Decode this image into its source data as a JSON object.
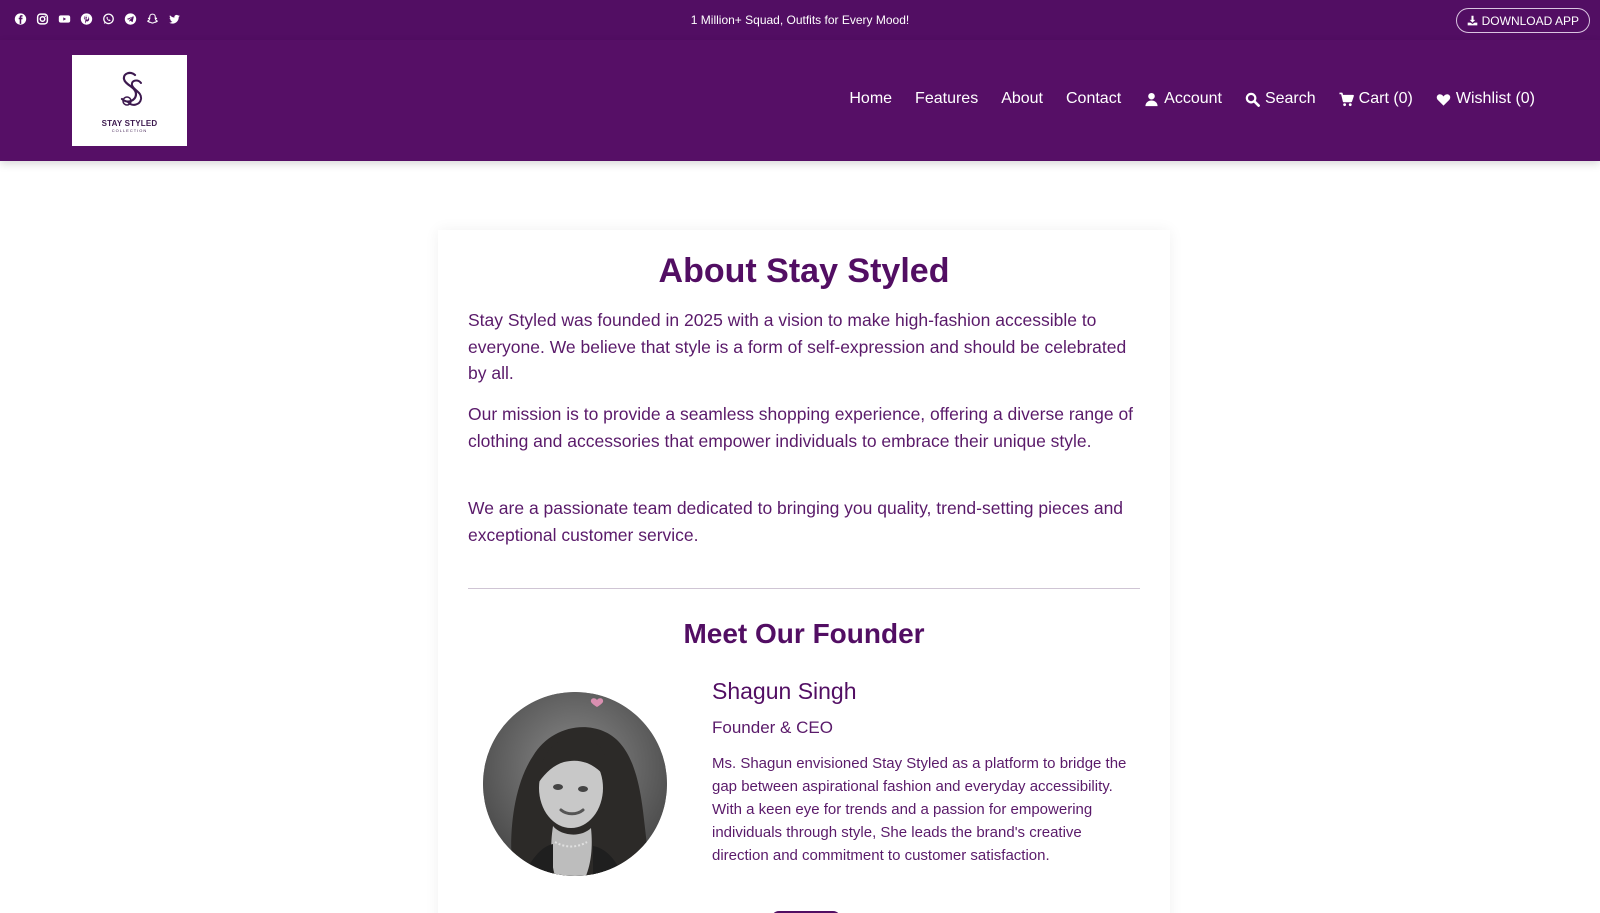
{
  "topbar": {
    "social_icons": [
      "facebook-icon",
      "instagram-icon",
      "youtube-icon",
      "pinterest-icon",
      "whatsapp-icon",
      "telegram-icon",
      "snapchat-icon",
      "twitter-icon"
    ],
    "tagline": "1 Million+ Squad, Outfits for Every Mood!",
    "download_label": "DOWNLOAD APP"
  },
  "brand": {
    "logo_text": "STAY STYLED",
    "logo_subtext": "COLLECTION"
  },
  "nav": {
    "home": "Home",
    "features": "Features",
    "about": "About",
    "contact": "Contact",
    "account": "Account",
    "search": "Search",
    "cart": "Cart (0)",
    "wishlist": "Wishlist (0)"
  },
  "about": {
    "title": "About Stay Styled",
    "paragraphs": [
      "Stay Styled was founded in 2025 with a vision to make high-fashion accessible to everyone. We believe that style is a form of self-expression and should be celebrated by all.",
      "Our mission is to provide a seamless shopping experience, offering a diverse range of clothing and accessories that empower individuals to embrace their unique style.",
      "We are a passionate team dedicated to bringing you quality, trend-setting pieces and exceptional customer service."
    ]
  },
  "founder": {
    "section_title": "Meet Our Founder",
    "name": "Shagun Singh",
    "role": "Founder & CEO",
    "bio": "Ms. Shagun envisioned Stay Styled as a platform to bridge the gap between aspirational fashion and everyday accessibility. With a keen eye for trends and a passion for empowering individuals through style, She leads the brand's creative direction and commitment to customer satisfaction."
  },
  "colors": {
    "brand_purple": "#520e63",
    "text_purple": "#5a1a6a",
    "white": "#ffffff"
  }
}
